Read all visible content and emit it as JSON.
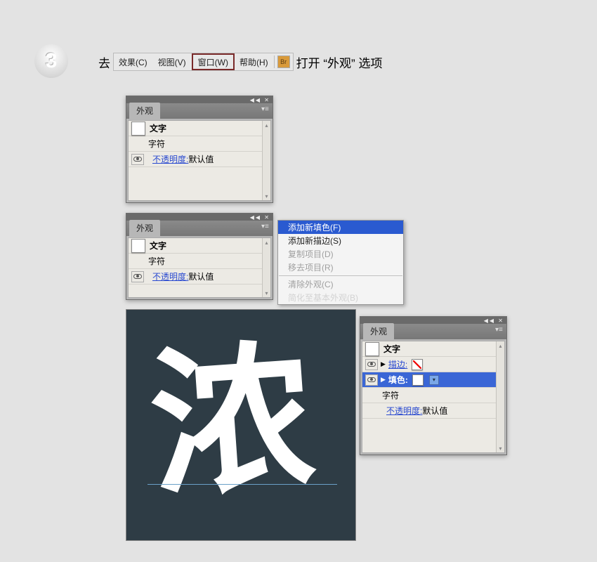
{
  "step": "3",
  "instruction_prefix": "去",
  "instruction_suffix": "打开 “外观” 选项",
  "menubar": {
    "items": [
      "效果(C)",
      "视图(V)",
      "窗口(W)",
      "帮助(H)"
    ],
    "highlighted_index": 2,
    "br_label": "Br"
  },
  "panel1": {
    "tab": "外观",
    "rows": {
      "type": "文字",
      "char": "字符",
      "opacity_label": "不透明度:",
      "opacity_value": "默认值"
    }
  },
  "panel2": {
    "tab": "外观",
    "rows": {
      "type": "文字",
      "char": "字符",
      "opacity_label": "不透明度:",
      "opacity_value": "默认值"
    }
  },
  "context_menu": {
    "items": [
      {
        "label": "添加新填色(F)",
        "state": "highlighted"
      },
      {
        "label": "添加新描边(S)",
        "state": "normal"
      },
      {
        "label": "复制项目(D)",
        "state": "disabled"
      },
      {
        "label": "移去项目(R)",
        "state": "disabled"
      },
      {
        "sep": true
      },
      {
        "label": "清除外观(C)",
        "state": "disabled"
      },
      {
        "label": "简化至基本外观(B)",
        "state": "disabled"
      }
    ]
  },
  "canvas": {
    "char": "浓"
  },
  "panel3": {
    "tab": "外观",
    "rows": {
      "type": "文字",
      "stroke_label": "描边:",
      "fill_label": "填色:",
      "char": "字符",
      "opacity_label": "不透明度:",
      "opacity_value": "默认值"
    }
  }
}
